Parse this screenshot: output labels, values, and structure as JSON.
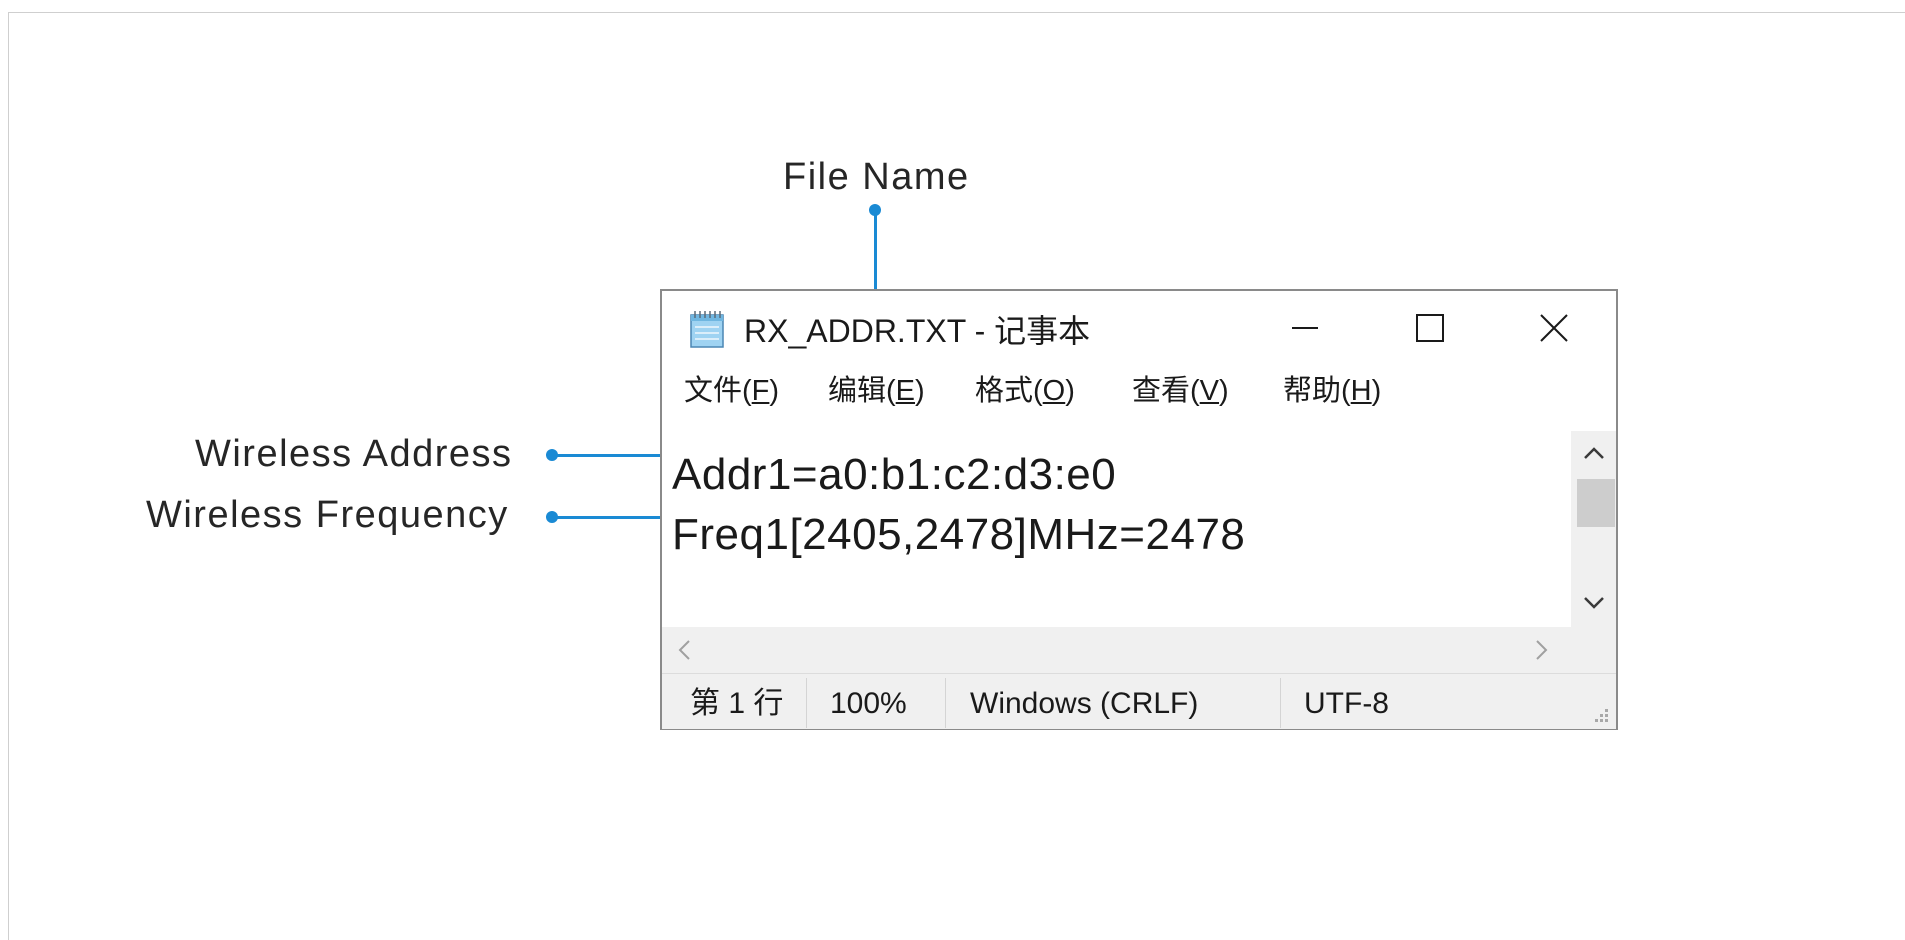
{
  "callouts": {
    "file_name": "File Name",
    "wireless_address": "Wireless Address",
    "wireless_frequency": "Wireless Frequency"
  },
  "window": {
    "title": "RX_ADDR.TXT - 记事本",
    "app_icon": "notepad-icon",
    "controls": {
      "minimize": "minimize-icon",
      "maximize": "maximize-icon",
      "close": "close-icon"
    }
  },
  "menu": {
    "items": [
      {
        "label": "文件(",
        "key": "F",
        "end": ")"
      },
      {
        "label": "编辑(",
        "key": "E",
        "end": ")"
      },
      {
        "label": "格式(",
        "key": "O",
        "end": ")"
      },
      {
        "label": "查看(",
        "key": "V",
        "end": ")"
      },
      {
        "label": "帮助(",
        "key": "H",
        "end": ")"
      }
    ]
  },
  "editor": {
    "lines": [
      "Addr1=a0:b1:c2:d3:e0",
      "Freq1[2405,2478]MHz=2478"
    ]
  },
  "status": {
    "line": "第 1 行",
    "zoom": "100%",
    "line_ending": "Windows (CRLF)",
    "encoding": "UTF-8"
  },
  "colors": {
    "accent": "#1a8ad4",
    "window_border": "#8a8a8a",
    "status_bg": "#f0f0f0"
  }
}
